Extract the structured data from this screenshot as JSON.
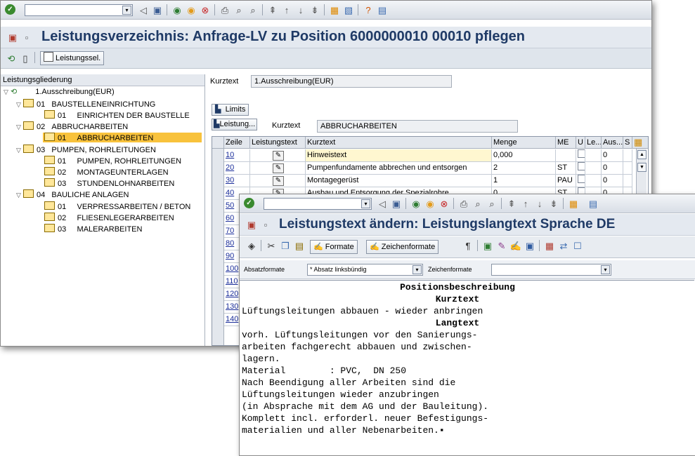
{
  "window1": {
    "toolbar": {
      "cmd_dd": "▾"
    },
    "title": "Leistungsverzeichnis: Anfrage-LV zu Position 6000000010 00010 pflegen",
    "app_button": "Leistungssel.",
    "tree": {
      "header": "Leistungsgliederung",
      "nodes": [
        {
          "label": "1.Ausschreibung(EUR)"
        },
        {
          "num": "01",
          "label": "BAUSTELLENEINRICHTUNG"
        },
        {
          "num": "01",
          "label": "EINRICHTEN DER BAUSTELLE"
        },
        {
          "num": "02",
          "label": "ABBRUCHARBEITEN"
        },
        {
          "num": "01",
          "label": "ABBRUCHARBEITEN"
        },
        {
          "num": "03",
          "label": "PUMPEN, ROHRLEITUNGEN"
        },
        {
          "num": "01",
          "label": "PUMPEN, ROHRLEITUNGEN"
        },
        {
          "num": "02",
          "label": "MONTAGEUNTERLAGEN"
        },
        {
          "num": "03",
          "label": "STUNDENLOHNARBEITEN"
        },
        {
          "num": "04",
          "label": "BAULICHE ANLAGEN"
        },
        {
          "num": "01",
          "label": "VERPRESSARBEITEN / BETON"
        },
        {
          "num": "02",
          "label": "FLIESENLEGERARBEITEN"
        },
        {
          "num": "03",
          "label": "MALERARBEITEN"
        }
      ]
    },
    "kurztext_label": "Kurztext",
    "kurztext_value": "1.Ausschreibung(EUR)",
    "limits_button": "Limits",
    "leistung_button": "Leistung...",
    "kurztext2_label": "Kurztext",
    "kurztext2_value": "ABBRUCHARBEITEN",
    "grid": {
      "headers": {
        "zeile": "Zeile",
        "leistungstext": "Leistungstext",
        "kurztext": "Kurztext",
        "menge": "Menge",
        "me": "ME",
        "u": "U",
        "le": "Le...",
        "aus": "Aus...",
        "st": "S"
      },
      "rows": [
        {
          "zeile": "10",
          "kurztext": "Hinweistext",
          "menge": "0,000",
          "me": "",
          "aus": "0"
        },
        {
          "zeile": "20",
          "kurztext": "Pumpenfundamente abbrechen und entsorgen",
          "menge": "2",
          "me": "ST",
          "aus": "0"
        },
        {
          "zeile": "30",
          "kurztext": "Montagegerüst",
          "menge": "1",
          "me": "PAU",
          "aus": "0"
        },
        {
          "zeile": "40",
          "kurztext": "Ausbau und Entsorgung der Spezialrohre",
          "menge": "0",
          "me": "ST",
          "aus": "0"
        },
        {
          "zeile": "50"
        },
        {
          "zeile": "60"
        },
        {
          "zeile": "70"
        },
        {
          "zeile": "80"
        },
        {
          "zeile": "90"
        },
        {
          "zeile": "100"
        },
        {
          "zeile": "110"
        },
        {
          "zeile": "120"
        },
        {
          "zeile": "130"
        },
        {
          "zeile": "140"
        }
      ]
    }
  },
  "window2": {
    "title": "Leistungstext ändern: Leistungslangtext Sprache DE",
    "formate_button": "Formate",
    "zeichenformate_button": "Zeichenformate",
    "absatzformate_label": "Absatzformate",
    "absatzformate_value": "* Absatz linksbündig",
    "zeichenformate_label": "Zeichenformate",
    "zeichenformate_value": "",
    "editor": {
      "heading1": "Positionsbeschreibung",
      "heading2": "Kurztext",
      "kurztext_line": "Lüftungsleitungen abbauen - wieder anbringen",
      "heading3": "Langtext",
      "lines": [
        "vorh. Lüftungsleitungen vor den Sanierungs-",
        "arbeiten fachgerecht abbauen und zwischen-",
        "lagern.",
        "Material        : PVC,  DN 250",
        "Nach Beendigung aller Arbeiten sind die",
        "Lüftungsleitungen wieder anzubringen",
        "(in Absprache mit dem AG und der Bauleitung).",
        "Komplett incl. erforderl. neuer Befestigungs-",
        "materialien und aller Nebenarbeiten.▪"
      ]
    }
  },
  "colors": {
    "title": "#1f3a66",
    "selected": "#f8c23c",
    "link": "#1a2d9a"
  },
  "icons": [
    "check-icon",
    "back-icon",
    "save-icon",
    "find-icon",
    "print-icon",
    "help-icon",
    "folder-icon",
    "edit-icon",
    "expand-icon",
    "collapse-icon"
  ]
}
